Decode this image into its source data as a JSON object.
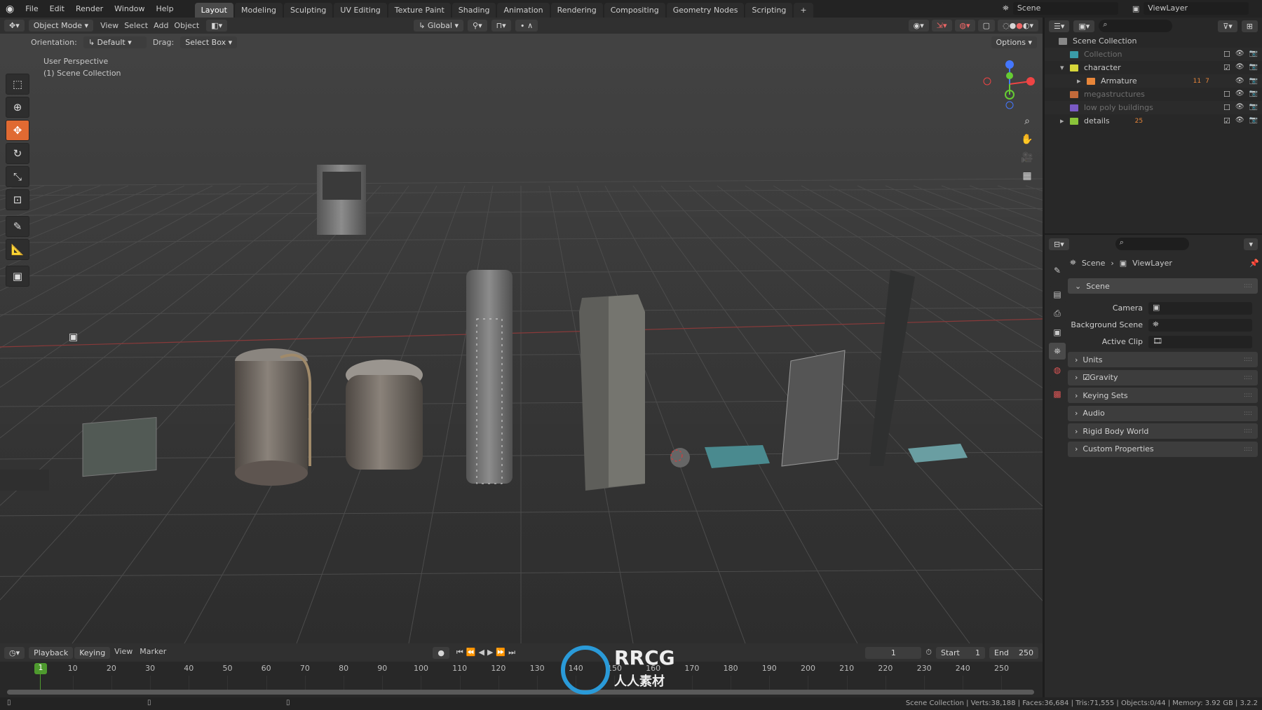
{
  "topbar": {
    "menus": [
      "File",
      "Edit",
      "Render",
      "Window",
      "Help"
    ],
    "workspaces": [
      "Layout",
      "Modeling",
      "Sculpting",
      "UV Editing",
      "Texture Paint",
      "Shading",
      "Animation",
      "Rendering",
      "Compositing",
      "Geometry Nodes",
      "Scripting"
    ],
    "active_workspace": "Layout",
    "add_tab": "+",
    "scene": "Scene",
    "view_layer": "ViewLayer"
  },
  "header": {
    "mode": "Object Mode",
    "menus": [
      "View",
      "Select",
      "Add",
      "Object"
    ],
    "transform_orientation": "Global"
  },
  "tool_settings": {
    "orientation_label": "Orientation:",
    "orientation_value": "Default",
    "drag_label": "Drag:",
    "drag_value": "Select Box",
    "options": "Options"
  },
  "viewport": {
    "view_name": "User Perspective",
    "collection": "(1) Scene Collection",
    "gizmo_axes": [
      "X",
      "Y",
      "Z"
    ]
  },
  "toolbar": {
    "tools": [
      "select-box",
      "cursor",
      "move",
      "rotate",
      "scale",
      "transform",
      "annotate",
      "measure",
      "add-cube"
    ]
  },
  "outliner": {
    "root": "Scene Collection",
    "items": [
      {
        "name": "Collection",
        "color": "#3a9ba8",
        "dim": true,
        "checked": false,
        "expand": ""
      },
      {
        "name": "character",
        "color": "#d6d63a",
        "dim": false,
        "checked": true,
        "expand": "▾"
      },
      {
        "name": "Armature",
        "color": "#e8863a",
        "dim": false,
        "checked": null,
        "expand": "▸",
        "child": true,
        "badges": [
          "11",
          "7"
        ]
      },
      {
        "name": "megastructures",
        "color": "#c46a3a",
        "dim": true,
        "checked": false,
        "expand": ""
      },
      {
        "name": "low poly buildings",
        "color": "#7a5ac4",
        "dim": true,
        "checked": false,
        "expand": ""
      },
      {
        "name": "details",
        "color": "#8ac43a",
        "dim": false,
        "checked": true,
        "expand": "▸",
        "badges": [
          "25"
        ]
      }
    ]
  },
  "properties": {
    "breadcrumb": [
      "Scene",
      "ViewLayer"
    ],
    "scene_panel": "Scene",
    "fields": [
      {
        "label": "Camera"
      },
      {
        "label": "Background Scene"
      },
      {
        "label": "Active Clip"
      }
    ],
    "panels": [
      "Units",
      "Gravity",
      "Keying Sets",
      "Audio",
      "Rigid Body World",
      "Custom Properties"
    ],
    "gravity_enabled": true
  },
  "timeline": {
    "menus": [
      "Playback",
      "Keying",
      "View",
      "Marker"
    ],
    "current_frame": "1",
    "start_label": "Start",
    "start": "1",
    "end_label": "End",
    "end": "250",
    "ticks": [
      "10",
      "20",
      "30",
      "40",
      "50",
      "60",
      "70",
      "80",
      "90",
      "100",
      "110",
      "120",
      "130",
      "140",
      "150",
      "160",
      "170",
      "180",
      "190",
      "200",
      "210",
      "220",
      "230",
      "240",
      "250"
    ]
  },
  "status": {
    "text": "Scene Collection | Verts:38,188 | Faces:36,684 | Tris:71,555 | Objects:0/44 | Memory: 3.92 GB | 3.2.2"
  },
  "watermark": "RRCG 人人素材"
}
